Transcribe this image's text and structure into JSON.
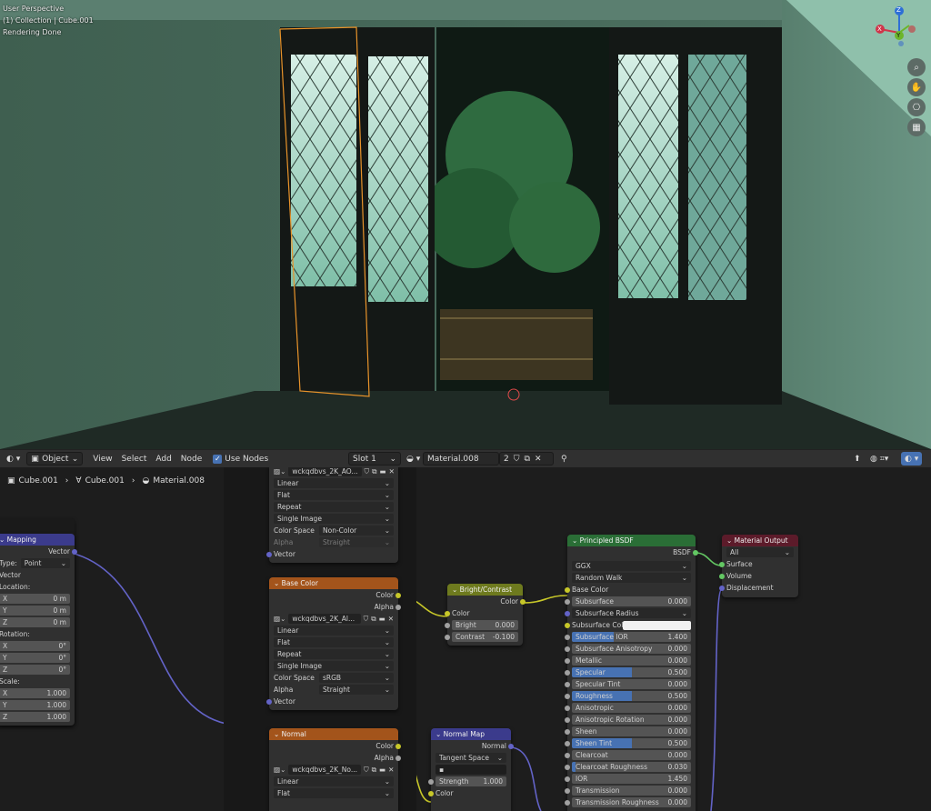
{
  "viewport": {
    "line1": "User Perspective",
    "line2": "(1) Collection | Cube.001",
    "line3": "Rendering Done",
    "gizmo": {
      "z": "Z",
      "y": "Y",
      "x": "X"
    }
  },
  "header": {
    "mode": "Object",
    "menus": [
      "View",
      "Select",
      "Add",
      "Node"
    ],
    "use_nodes_label": "Use Nodes",
    "slot": "Slot 1",
    "material": "Material.008",
    "users": "2"
  },
  "breadcrumb": {
    "object": "Cube.001",
    "mesh": "Cube.001",
    "material": "Material.008"
  },
  "nodes": {
    "mapping": {
      "title": "Mapping",
      "vector_out": "Vector",
      "type_label": "Type:",
      "type_value": "Point",
      "vector_label": "Vector",
      "location_label": "Location:",
      "location": [
        {
          "axis": "X",
          "value": "0 m"
        },
        {
          "axis": "Y",
          "value": "0 m"
        },
        {
          "axis": "Z",
          "value": "0 m"
        }
      ],
      "rotation_label": "Rotation:",
      "rotation": [
        {
          "axis": "X",
          "value": "0°"
        },
        {
          "axis": "Y",
          "value": "0°"
        },
        {
          "axis": "Z",
          "value": "0°"
        }
      ],
      "scale_label": "Scale:",
      "scale": [
        {
          "axis": "X",
          "value": "1.000"
        },
        {
          "axis": "Y",
          "value": "1.000"
        },
        {
          "axis": "Z",
          "value": "1.000"
        }
      ]
    },
    "ao": {
      "image": "wckqdbvs_2K_AO...",
      "interp": "Linear",
      "proj": "Flat",
      "ext": "Repeat",
      "source": "Single Image",
      "cs_label": "Color Space",
      "cs": "Non-Color",
      "alpha_label": "Alpha",
      "alpha": "Straight",
      "vector": "Vector"
    },
    "base": {
      "title": "Base Color",
      "color": "Color",
      "alpha_out": "Alpha",
      "image": "wckqdbvs_2K_Al...",
      "interp": "Linear",
      "proj": "Flat",
      "ext": "Repeat",
      "source": "Single Image",
      "cs_label": "Color Space",
      "cs": "sRGB",
      "alpha_label": "Alpha",
      "alpha": "Straight",
      "vector": "Vector"
    },
    "normal": {
      "title": "Normal",
      "color": "Color",
      "alpha_out": "Alpha",
      "image": "wckqdbvs_2K_No...",
      "interp": "Linear",
      "proj": "Flat"
    },
    "bc": {
      "title": "Bright/Contrast",
      "color_out": "Color",
      "color_in": "Color",
      "bright_label": "Bright",
      "bright": "0.000",
      "contrast_label": "Contrast",
      "contrast": "-0.100"
    },
    "nmap": {
      "title": "Normal Map",
      "normal_out": "Normal",
      "space": "Tangent Space",
      "strength_label": "Strength",
      "strength": "1.000",
      "color_in": "Color"
    },
    "bsdf": {
      "title": "Principled BSDF",
      "out": "BSDF",
      "dist": "GGX",
      "sss_method": "Random Walk",
      "base_color": "Base Color",
      "sss_color_label": "Subsurface Colo",
      "sss_radius": "Subsurface Radius",
      "fields": [
        {
          "label": "Subsurface",
          "value": "0.000",
          "frac": 0
        },
        {
          "label": "Subsurface IOR",
          "value": "1.400",
          "frac": 0.35
        },
        {
          "label": "Subsurface Anisotropy",
          "value": "0.000",
          "frac": 0
        },
        {
          "label": "Metallic",
          "value": "0.000",
          "frac": 0
        },
        {
          "label": "Specular",
          "value": "0.500",
          "frac": 0.5
        },
        {
          "label": "Specular Tint",
          "value": "0.000",
          "frac": 0
        },
        {
          "label": "Roughness",
          "value": "0.500",
          "frac": 0.5
        },
        {
          "label": "Anisotropic",
          "value": "0.000",
          "frac": 0
        },
        {
          "label": "Anisotropic Rotation",
          "value": "0.000",
          "frac": 0
        },
        {
          "label": "Sheen",
          "value": "0.000",
          "frac": 0
        },
        {
          "label": "Sheen Tint",
          "value": "0.500",
          "frac": 0.5
        },
        {
          "label": "Clearcoat",
          "value": "0.000",
          "frac": 0
        },
        {
          "label": "Clearcoat Roughness",
          "value": "0.030",
          "frac": 0.03
        },
        {
          "label": "IOR",
          "value": "1.450",
          "frac": 0
        },
        {
          "label": "Transmission",
          "value": "0.000",
          "frac": 0
        },
        {
          "label": "Transmission Roughness",
          "value": "0.000",
          "frac": 0
        }
      ]
    },
    "output": {
      "title": "Material Output",
      "target": "All",
      "surface": "Surface",
      "volume": "Volume",
      "displacement": "Displacement"
    }
  },
  "colors": {
    "accent": "#4772b3",
    "shader_header": "#2a6e36",
    "texture_header": "#a3541b",
    "output_header": "#5c1b2a",
    "vector_header": "#3b3b8c",
    "color_header": "#6e7a1e"
  }
}
